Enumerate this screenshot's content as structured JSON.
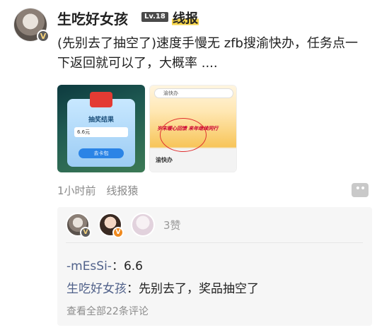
{
  "post": {
    "author_name": "生吃好女孩",
    "level_badge": "Lv.18",
    "flair": "线报",
    "avatar_badge": "V",
    "content": "(先别去了抽空了)速度手慢无 zfb搜渝快办，任务点一下返回就可以了，大概率 ....",
    "time_ago": "1小时前",
    "source": "线报猿",
    "more_label": "••"
  },
  "thumbnails": [
    {
      "title": "抽奖结果",
      "amount": "6.6元",
      "button": "去卡包"
    },
    {
      "search_text": "渝快办",
      "banner_text": "岁末暖心回馈 来年继续同行",
      "app_name": "渝快办"
    }
  ],
  "likes": {
    "count_label": "3赞",
    "avatar_badges": [
      "V",
      "V"
    ]
  },
  "comments": [
    {
      "user": "-mEsSi-",
      "sep": "：",
      "text": "6.6"
    },
    {
      "user": "生吃好女孩",
      "sep": "：",
      "text": "先别去了，奖品抽空了"
    }
  ],
  "view_all_label": "查看全部22条评论"
}
